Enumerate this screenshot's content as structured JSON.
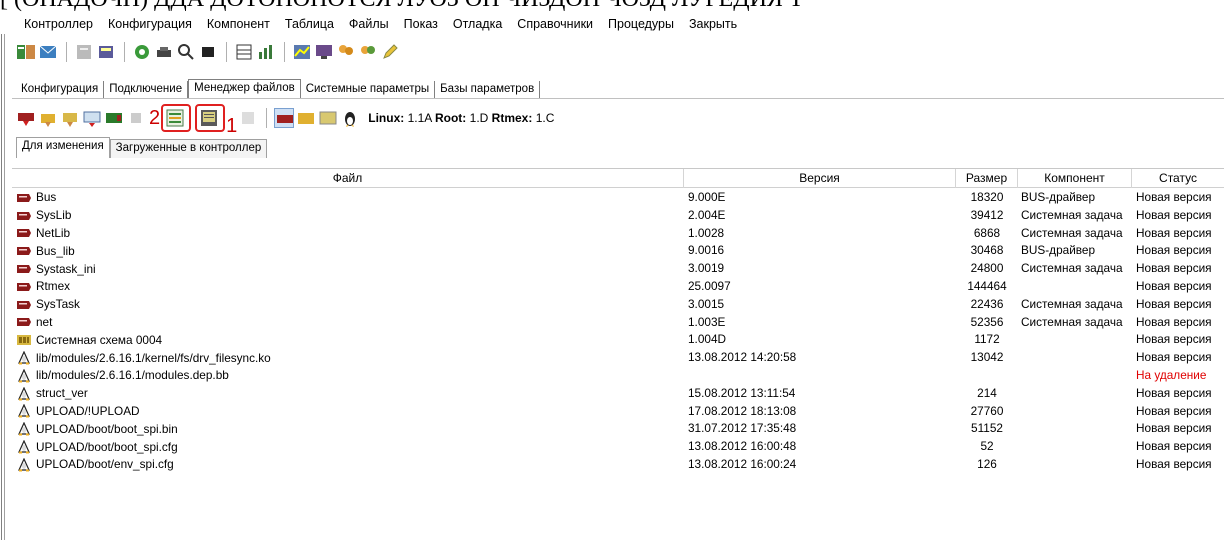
{
  "menu": [
    "Контроллер",
    "Конфигурация",
    "Компонент",
    "Таблица",
    "Файлы",
    "Показ",
    "Отладка",
    "Справочники",
    "Процедуры",
    "Закрыть"
  ],
  "main_tabs": [
    "Конфигурация",
    "Подключение",
    "Менеджер файлов",
    "Системные параметры",
    "Базы параметров"
  ],
  "callouts": {
    "two": "2",
    "one": "1"
  },
  "version_info": {
    "linux_label": "Linux:",
    "linux_val": "1.1A",
    "root_label": "Root:",
    "root_val": "1.D",
    "rtmex_label": "Rtmex:",
    "rtmex_val": "1.C"
  },
  "sub_tabs": [
    "Для изменения",
    "Загруженные в контроллер"
  ],
  "columns": [
    "Файл",
    "Версия",
    "Размер",
    "Компонент",
    "Статус"
  ],
  "rows": [
    {
      "icon": "module-icon",
      "file": "Bus",
      "version": "9.000E",
      "size": "18320",
      "component": "BUS-драйвер",
      "status": "Новая версия"
    },
    {
      "icon": "module-icon",
      "file": "SysLib",
      "version": "2.004E",
      "size": "39412",
      "component": "Системная задача",
      "status": "Новая версия"
    },
    {
      "icon": "module-icon",
      "file": "NetLib",
      "version": "1.0028",
      "size": "6868",
      "component": "Системная задача",
      "status": "Новая версия"
    },
    {
      "icon": "module-icon",
      "file": "Bus_lib",
      "version": "9.0016",
      "size": "30468",
      "component": "BUS-драйвер",
      "status": "Новая версия"
    },
    {
      "icon": "module-icon",
      "file": "Systask_ini",
      "version": "3.0019",
      "size": "24800",
      "component": "Системная задача",
      "status": "Новая версия"
    },
    {
      "icon": "module-icon",
      "file": "Rtmex",
      "version": "25.0097",
      "size": "144464",
      "component": "",
      "status": "Новая версия"
    },
    {
      "icon": "module-icon",
      "file": "SysTask",
      "version": "3.0015",
      "size": "22436",
      "component": "Системная задача",
      "status": "Новая версия"
    },
    {
      "icon": "module-icon",
      "file": "net",
      "version": "1.003E",
      "size": "52356",
      "component": "Системная задача",
      "status": "Новая версия"
    },
    {
      "icon": "scheme-icon",
      "file": "Системная схема 0004",
      "version": "1.004D",
      "size": "1172",
      "component": "",
      "status": "Новая версия"
    },
    {
      "icon": "linux-icon",
      "file": "lib/modules/2.6.16.1/kernel/fs/drv_filesync.ko",
      "version": "13.08.2012 14:20:58",
      "size": "13042",
      "component": "",
      "status": "Новая версия"
    },
    {
      "icon": "linux-icon",
      "file": "lib/modules/2.6.16.1/modules.dep.bb",
      "version": "",
      "size": "",
      "component": "",
      "status": "На удаление",
      "status_red": true
    },
    {
      "icon": "linux-icon",
      "file": "struct_ver",
      "version": "15.08.2012 13:11:54",
      "size": "214",
      "component": "",
      "status": "Новая версия"
    },
    {
      "icon": "linux-icon",
      "file": "UPLOAD/!UPLOAD",
      "version": "17.08.2012 18:13:08",
      "size": "27760",
      "component": "",
      "status": "Новая версия"
    },
    {
      "icon": "linux-icon",
      "file": "UPLOAD/boot/boot_spi.bin",
      "version": "31.07.2012 17:35:48",
      "size": "51152",
      "component": "",
      "status": "Новая версия"
    },
    {
      "icon": "linux-icon",
      "file": "UPLOAD/boot/boot_spi.cfg",
      "version": "13.08.2012 16:00:48",
      "size": "52",
      "component": "",
      "status": "Новая версия"
    },
    {
      "icon": "linux-icon",
      "file": "UPLOAD/boot/env_spi.cfg",
      "version": "13.08.2012 16:00:24",
      "size": "126",
      "component": "",
      "status": "Новая версия"
    }
  ],
  "colors": {
    "callout_red": "#e02020",
    "delete_status": "#e00000",
    "module_icon": "#8b1a1a"
  }
}
